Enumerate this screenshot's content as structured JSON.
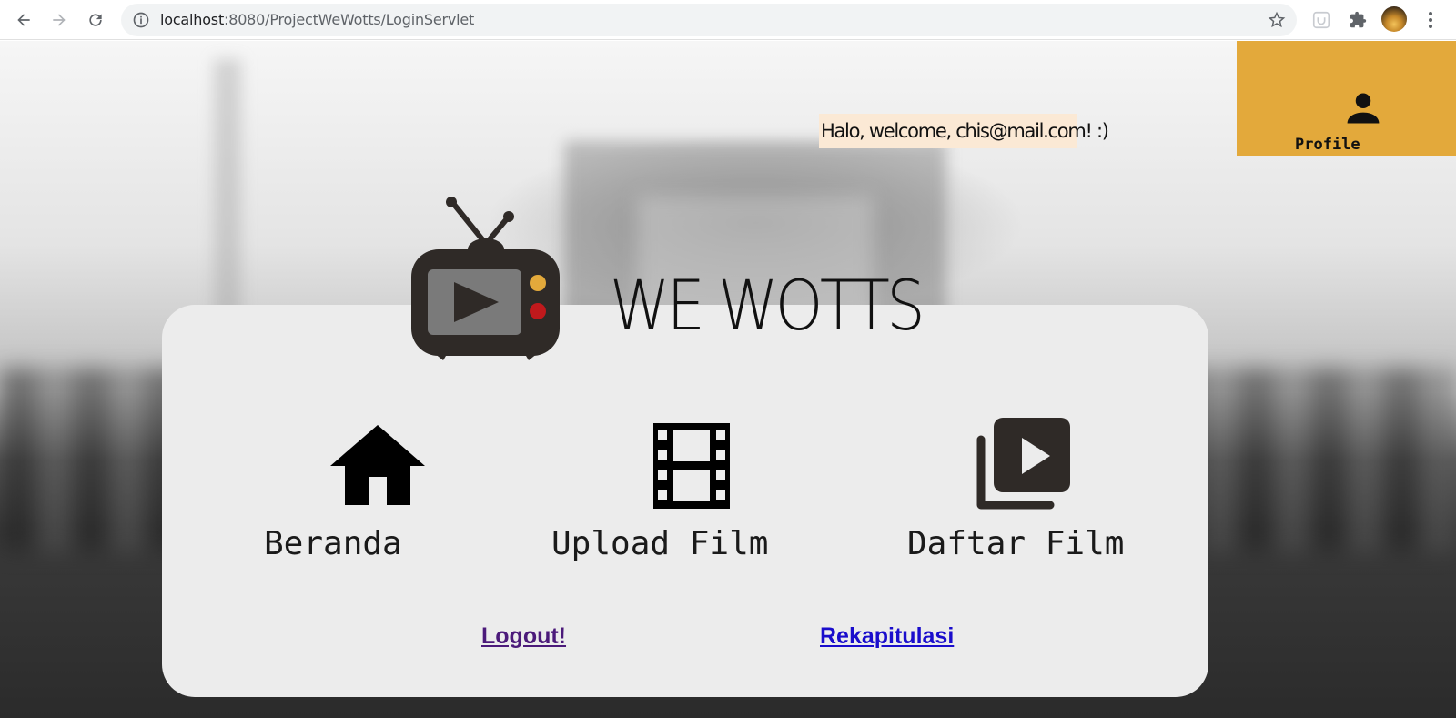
{
  "browser": {
    "url_host": "localhost",
    "url_path": ":8080/ProjectWeWotts/LoginServlet",
    "icons": [
      "back-icon",
      "forward-icon",
      "reload-icon",
      "info-icon",
      "star-icon",
      "extension-icon",
      "puzzle-icon",
      "avatar",
      "menu-icon"
    ]
  },
  "header": {
    "welcome_text": "Halo, welcome, chis@mail.com! :)",
    "profile_label": "Profile",
    "profile_color": "#e3a93b"
  },
  "brand": {
    "name": "WE WOTTS"
  },
  "menu": {
    "items": [
      {
        "label": "Beranda",
        "icon": "home-icon"
      },
      {
        "label": "Upload Film",
        "icon": "film-strip-icon"
      },
      {
        "label": "Daftar Film",
        "icon": "video-library-icon"
      }
    ]
  },
  "links": {
    "logout": "Logout!",
    "rekapitulasi": "Rekapitulasi"
  }
}
